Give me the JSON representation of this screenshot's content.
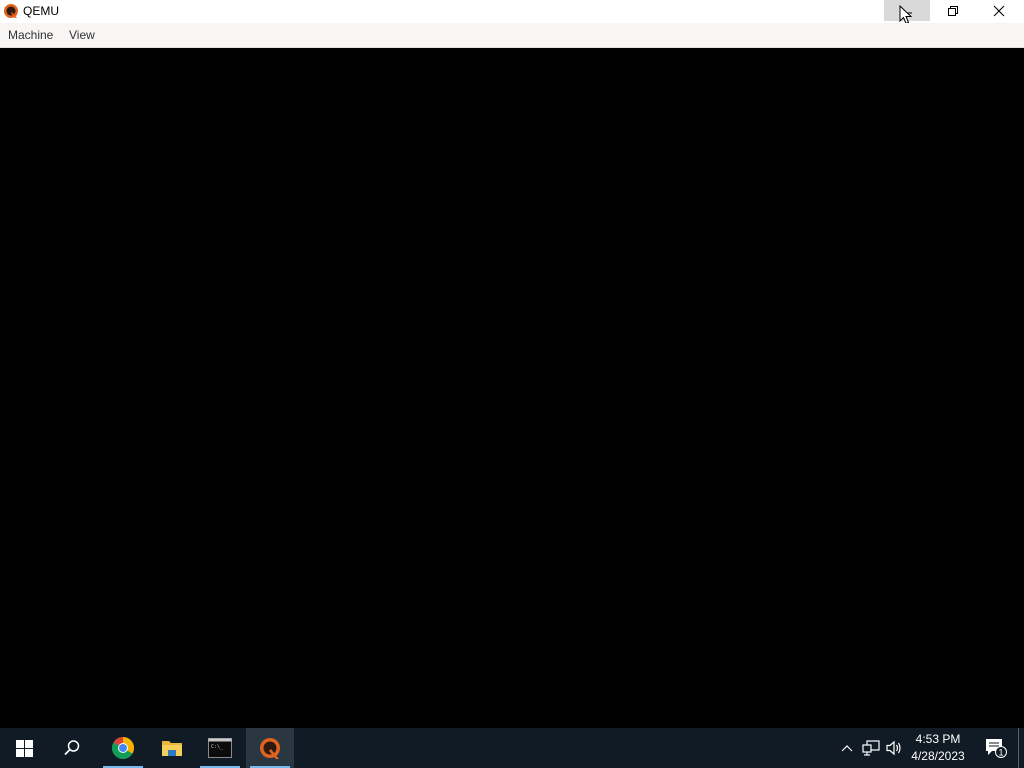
{
  "window": {
    "title": "QEMU",
    "menu": [
      {
        "label": "Machine"
      },
      {
        "label": "View"
      }
    ],
    "controls": {
      "minimize": "minimize-icon",
      "restore": "restore-icon",
      "close": "close-icon"
    }
  },
  "taskbar": {
    "apps": [
      "start-icon",
      "search-icon",
      "chrome-icon",
      "file-explorer-icon",
      "command-prompt-icon",
      "qemu-icon"
    ],
    "tray": {
      "time": "4:53 PM",
      "date": "4/28/2023",
      "notification_count": "1"
    }
  },
  "colors": {
    "taskbar_bg": "#101b25",
    "accent": "#76b9ed",
    "screen_bg": "#000000"
  }
}
